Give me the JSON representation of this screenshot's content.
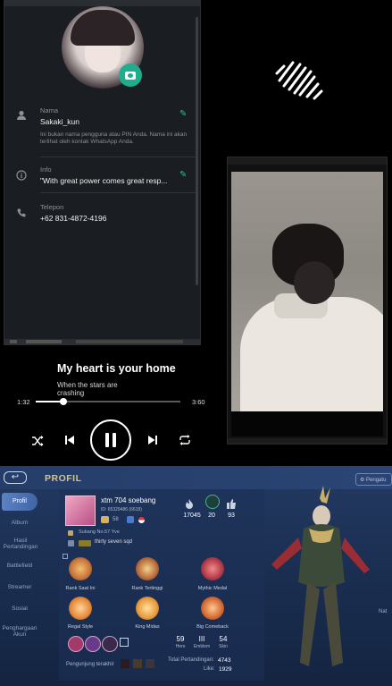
{
  "whatsapp": {
    "name_label": "Nama",
    "name_value": "Sakaki_kun",
    "name_hint": "Ini bukan nama pengguna atau PIN Anda. Nama ini akan terlihat oleh kontak WhatsApp Anda.",
    "info_label": "Info",
    "info_value": "\"With great power comes great resp...",
    "phone_label": "Telepon",
    "phone_value": "+62 831-4872-4196",
    "accent": "#1fae8d"
  },
  "player": {
    "song_title": "My heart is your home",
    "lyric": "When the stars are crashing",
    "elapsed": "1:32",
    "duration": "3:60",
    "progress": 0.19
  },
  "game": {
    "page_title": "PROFIL",
    "top_button": "Pengatu",
    "sidebar": [
      "Profil",
      "Album",
      "Hasil Pertandingan",
      "Battlefield",
      "Streamer",
      "Sosial",
      "Penghargaan Akun"
    ],
    "username": "xtm 704 soebang",
    "id_text": "ID: 65329486 (6618)",
    "level": "58",
    "stats": [
      {
        "icon": "flame-icon",
        "value": "17045"
      },
      {
        "icon": "star-icon",
        "value": "20"
      },
      {
        "icon": "thumbs-up-icon",
        "value": "93"
      }
    ],
    "location": "Subang No.57 Yve",
    "squad": "thirty seven sqd",
    "medals": [
      {
        "label": "Rank Saat Ini",
        "color": "#c8733a"
      },
      {
        "label": "Rank Tertinggi",
        "color": "#b86a3c"
      },
      {
        "label": "Mythic Medal",
        "color": "#b03a4a"
      },
      {
        "label": "Regal Style",
        "color": "#e58a3a"
      },
      {
        "label": "King Midas",
        "color": "#e89b3c"
      },
      {
        "label": "Big Comeback",
        "color": "#d26a32"
      }
    ],
    "counts": [
      {
        "value": "59",
        "label": "Hero"
      },
      {
        "value": "III",
        "label": "Emblem"
      },
      {
        "value": "54",
        "label": "Skin"
      }
    ],
    "visitors_label": "Pengunjung terakhir",
    "total_matches_label": "Total Pertandingan:",
    "total_matches_value": "4743",
    "likes_label": "Like:",
    "likes_value": "1929"
  }
}
